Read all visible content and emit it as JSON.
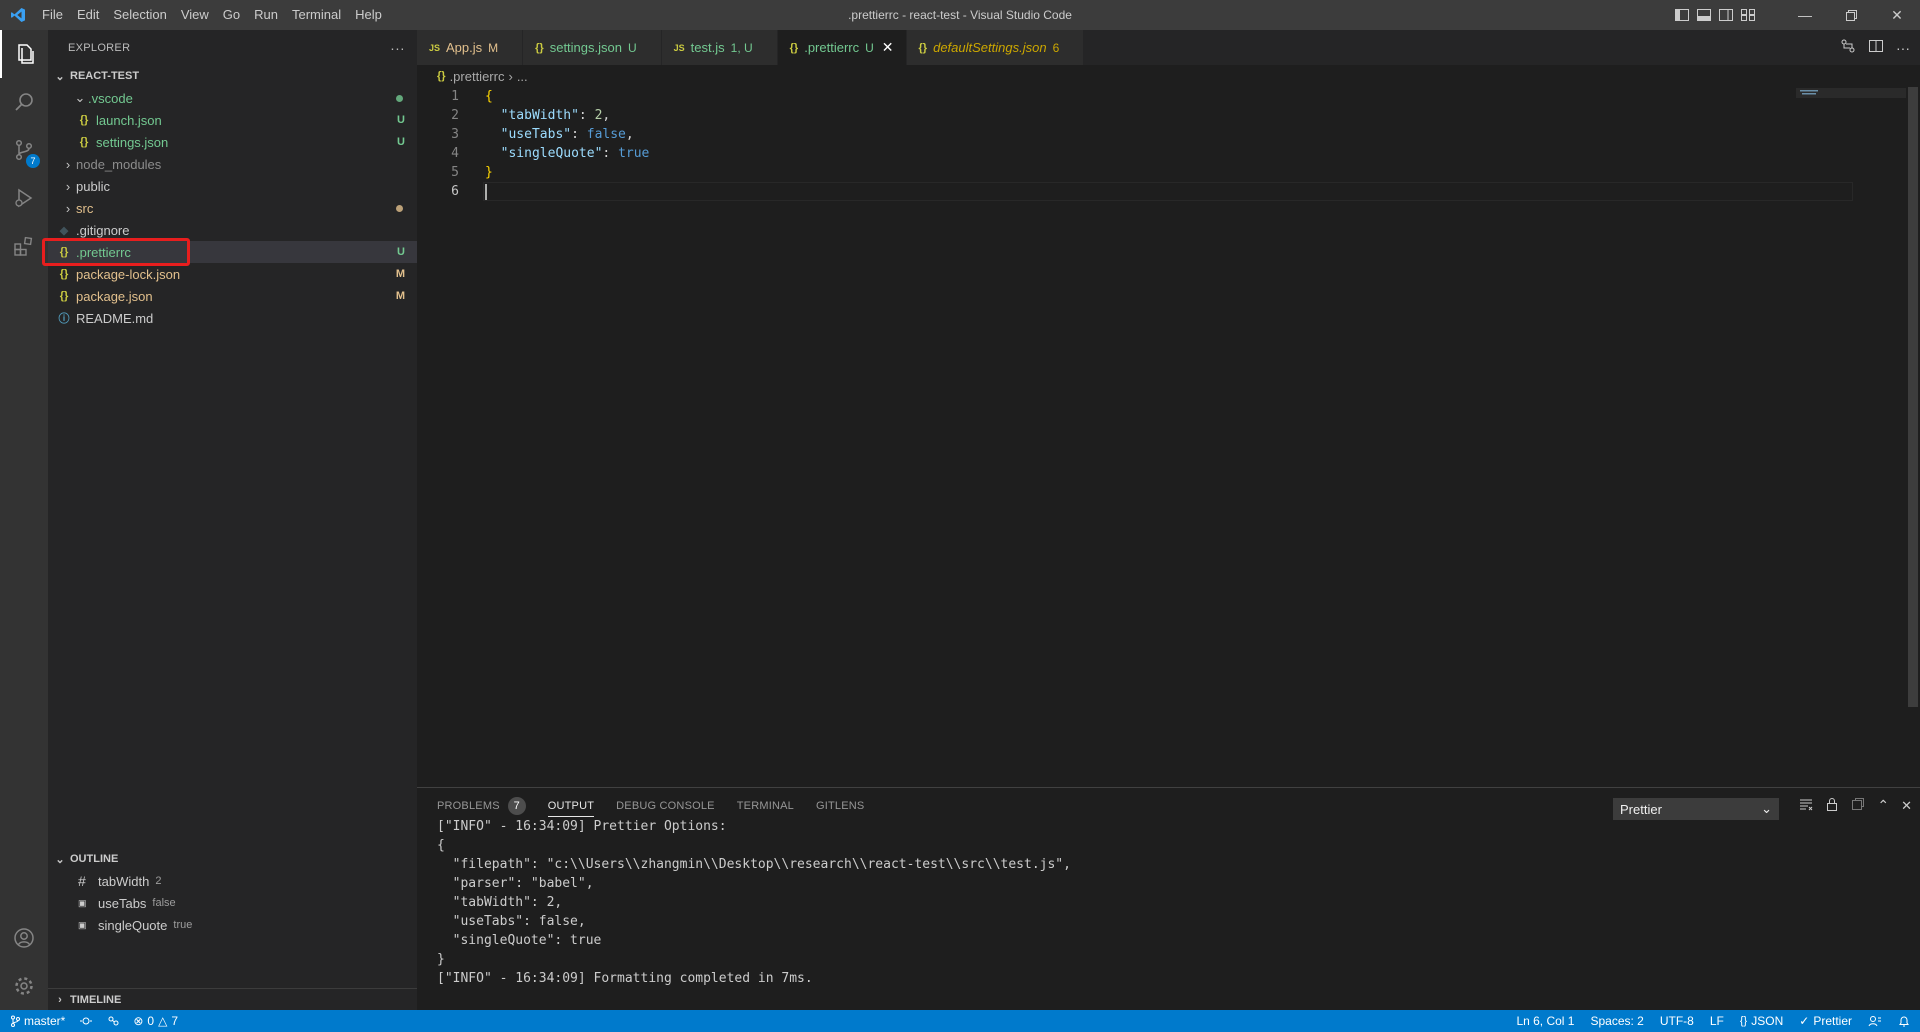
{
  "window": {
    "title": ".prettierrc - react-test - Visual Studio Code",
    "menu": [
      "File",
      "Edit",
      "Selection",
      "View",
      "Go",
      "Run",
      "Terminal",
      "Help"
    ]
  },
  "activity_bar": {
    "source_control_badge": "7"
  },
  "explorer": {
    "header": "EXPLORER",
    "more": "···",
    "root": "REACT-TEST",
    "items": [
      {
        "label": ".vscode",
        "type": "folder-open",
        "decoration": "",
        "color": "#73c991"
      },
      {
        "label": "launch.json",
        "type": "json",
        "decoration": "U",
        "color": "#73c991"
      },
      {
        "label": "settings.json",
        "type": "json",
        "decoration": "U",
        "color": "#73c991"
      },
      {
        "label": "node_modules",
        "type": "folder",
        "decoration": "",
        "color": "#8c8c8c"
      },
      {
        "label": "public",
        "type": "folder",
        "decoration": "",
        "color": "#cccccc"
      },
      {
        "label": "src",
        "type": "folder",
        "decoration": "",
        "color": "#e2c08d"
      },
      {
        "label": ".gitignore",
        "type": "git",
        "decoration": "",
        "color": "#cccccc"
      },
      {
        "label": ".prettierrc",
        "type": "json",
        "decoration": "U",
        "color": "#73c991"
      },
      {
        "label": "package-lock.json",
        "type": "json",
        "decoration": "M",
        "color": "#e2c08d"
      },
      {
        "label": "package.json",
        "type": "json",
        "decoration": "M",
        "color": "#e2c08d"
      },
      {
        "label": "README.md",
        "type": "info",
        "decoration": "",
        "color": "#cccccc"
      }
    ]
  },
  "outline": {
    "header": "OUTLINE",
    "items": [
      {
        "label": "tabWidth",
        "value": "2"
      },
      {
        "label": "useTabs",
        "value": "false"
      },
      {
        "label": "singleQuote",
        "value": "true"
      }
    ]
  },
  "timeline": {
    "header": "TIMELINE"
  },
  "tabs": [
    {
      "icon": "JS",
      "label": "App.js",
      "decoration": "M",
      "color": "#e2c08d"
    },
    {
      "icon": "{}",
      "label": "settings.json",
      "decoration": "U",
      "color": "#73c991"
    },
    {
      "icon": "JS",
      "label": "test.js",
      "decoration": "1, U",
      "color": "#73c991"
    },
    {
      "icon": "{}",
      "label": ".prettierrc",
      "decoration": "U",
      "color": "#73c991",
      "active": true
    },
    {
      "icon": "{}",
      "label": "defaultSettings.json",
      "decoration": "6",
      "color": "#cca700"
    }
  ],
  "breadcrumb": {
    "file": ".prettierrc",
    "rest": "..."
  },
  "editor": {
    "lines": [
      {
        "n": "1",
        "tokens": [
          [
            "{",
            "#ffd700"
          ]
        ]
      },
      {
        "n": "2",
        "tokens": [
          [
            "  \"tabWidth\"",
            "#9cdcfe"
          ],
          [
            ": ",
            "#d4d4d4"
          ],
          [
            "2",
            "#b5cea8"
          ],
          [
            ",",
            "#d4d4d4"
          ]
        ]
      },
      {
        "n": "3",
        "tokens": [
          [
            "  \"useTabs\"",
            "#9cdcfe"
          ],
          [
            ": ",
            "#d4d4d4"
          ],
          [
            "false",
            "#569cd6"
          ],
          [
            ",",
            "#d4d4d4"
          ]
        ]
      },
      {
        "n": "4",
        "tokens": [
          [
            "  \"singleQuote\"",
            "#9cdcfe"
          ],
          [
            ": ",
            "#d4d4d4"
          ],
          [
            "true",
            "#569cd6"
          ]
        ]
      },
      {
        "n": "5",
        "tokens": [
          [
            "}",
            "#ffd700"
          ]
        ]
      },
      {
        "n": "6",
        "tokens": []
      }
    ]
  },
  "panel": {
    "tabs": [
      "PROBLEMS",
      "OUTPUT",
      "DEBUG CONSOLE",
      "TERMINAL",
      "GITLENS"
    ],
    "problems_count": "7",
    "output_channel": "Prettier",
    "output_lines": [
      "[\"INFO\" - 16:34:09] Prettier Options:",
      "{",
      "  \"filepath\": \"c:\\\\Users\\\\zhangmin\\\\Desktop\\\\research\\\\react-test\\\\src\\\\test.js\",",
      "  \"parser\": \"babel\",",
      "  \"tabWidth\": 2,",
      "  \"useTabs\": false,",
      "  \"singleQuote\": true",
      "}",
      "[\"INFO\" - 16:34:09] Formatting completed in 7ms."
    ]
  },
  "statusbar": {
    "branch": "master*",
    "errors": "0",
    "warnings": "7",
    "position": "Ln 6, Col 1",
    "spaces": "Spaces: 2",
    "encoding": "UTF-8",
    "eol": "LF",
    "language": "JSON",
    "formatter": "Prettier"
  }
}
